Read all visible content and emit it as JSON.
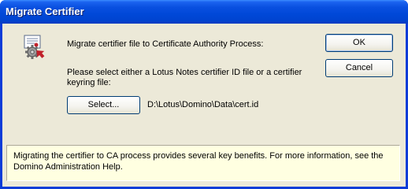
{
  "window": {
    "title": "Migrate Certifier"
  },
  "dialog": {
    "instruction": "Migrate certifier file to Certificate Authority Process:",
    "select_prompt": "Please select either a Lotus Notes certifier ID file or a certifier keyring file:",
    "select_button": "Select...",
    "file_path": "D:\\Lotus\\Domino\\Data\\cert.id",
    "ok_button": "OK",
    "cancel_button": "Cancel",
    "info_text": "Migrating the certifier to CA process provides several key benefits.  For more information, see the Domino Administration Help."
  },
  "icons": {
    "dialog_icon": "certificate-gear-icon"
  },
  "colors": {
    "titlebar": "#0a50e0",
    "dialog_background": "#ece9d8",
    "info_panel": "#ffffe1",
    "button_border": "#003c74"
  }
}
